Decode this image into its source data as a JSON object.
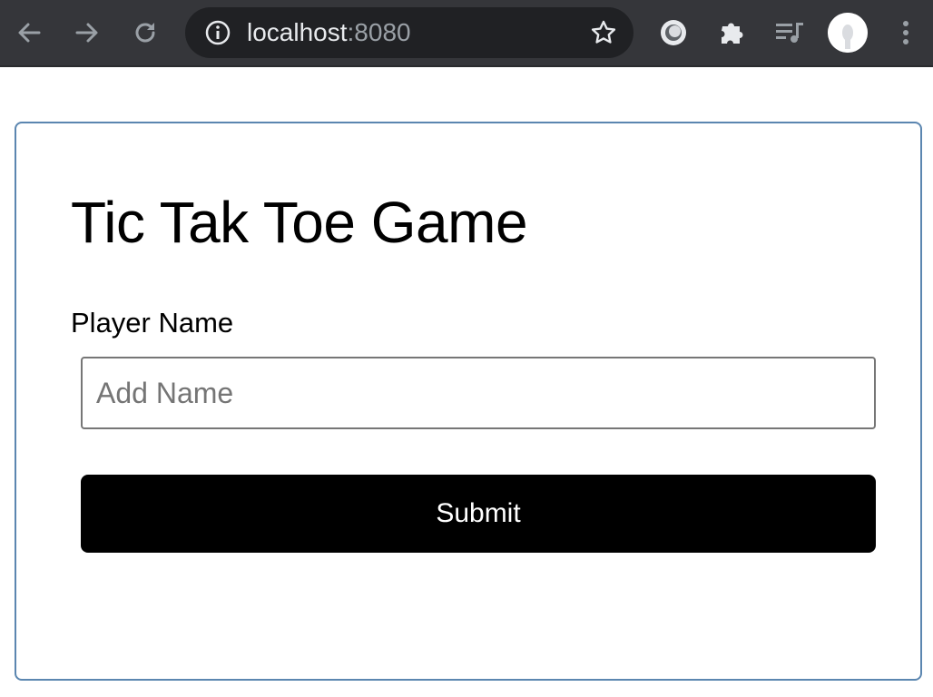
{
  "browser": {
    "url_host": "localhost",
    "url_port": ":8080",
    "icons": {
      "back": "arrow-left-icon",
      "forward": "arrow-right-icon",
      "reload": "reload-icon",
      "info": "info-icon",
      "bookmark": "star-icon",
      "extension_1": "circle-extension-icon",
      "extensions": "puzzle-icon",
      "media": "media-queue-icon",
      "menu": "kebab-menu-icon"
    },
    "colors": {
      "toolbar": "#35363a",
      "omnibox": "#202124",
      "icon": "#9aa0a6",
      "icon_active": "#e8eaed"
    }
  },
  "page": {
    "title": "Tic Tak Toe Game",
    "player_label": "Player Name",
    "name_input": {
      "value": "",
      "placeholder": "Add Name"
    },
    "submit_label": "Submit",
    "colors": {
      "card_border": "#5b86b0",
      "button_bg": "#000000",
      "button_text": "#ffffff"
    }
  }
}
